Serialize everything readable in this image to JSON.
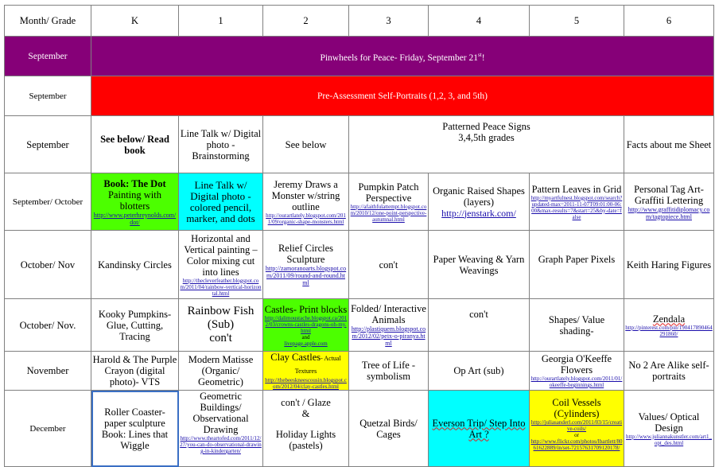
{
  "header": {
    "month_grade": "Month/ Grade",
    "grades": [
      "K",
      "1",
      "2",
      "3",
      "4",
      "5",
      "6"
    ]
  },
  "colors": {
    "purple_band": "#860078",
    "red_band": "#ff0000",
    "green": "#4cff00",
    "cyan": "#00ffff",
    "yellow": "#ffff00",
    "border": "#808080",
    "link": "#1a0dab"
  },
  "rows": {
    "r1": {
      "month": "September",
      "band_text": "Pinwheels for Peace-  Friday, September 21",
      "band_sup": "st",
      "band_end": "!"
    },
    "r2": {
      "month": "September",
      "band_text": "Pre-Assessment Self-Portraits (1,2, 3, and 5th)"
    },
    "r3": {
      "month": "September",
      "k": "See below/ Read book",
      "g1": "Line Talk w/ Digital photo - Brainstorming",
      "g2": "See below",
      "g345_line1": "Patterned Peace Signs",
      "g345_line2": "3,4,5th grades",
      "g6": "Facts about me Sheet"
    },
    "r4": {
      "month": "September/ October",
      "k_title": "Book: The Dot",
      "k_sub": "Painting with blotters",
      "k_link": "http://www.peterhreynolds.com/dot/",
      "g1": "Line Talk w/ Digital photo - colored pencil, marker, and dots",
      "g2_title": "Jeremy Draws a Monster w/string outline",
      "g2_link": "http://ourartlately.blogspot.com/2011/09/organic-shape-monsters.html",
      "g3_title": "Pumpkin Patch Perspective",
      "g3_link": "http://afaithfulattempt.blogspot.com/2010/12/one-point-perspective-autumnal.html",
      "g4_title": "Organic Raised Shapes (layers)",
      "g4_link": "http://jenstark.com/",
      "g5_title": "Pattern Leaves in Grid",
      "g5_link": "http://myartfulnest.blogspot.com/search?updated-max=2011-11-07T09:01:00-06:00&max-results=7&start=25&by-date=false",
      "g6_title": "Personal Tag Art- Graffiti Lettering",
      "g6_link": "http://www.graffitidiplomacy.com/tagtopiece.html"
    },
    "r5": {
      "month": "October/ Nov",
      "k": "Kandinsky Circles",
      "g1_title": "Horizontal and Vertical painting – Color mixing cut into lines",
      "g1_link": "http://thecleverfeather.blogspot.com/2011/04/rainbow-vertical-horizontal.html",
      "g2_title": "Relief Circles Sculpture",
      "g2_link": "http://zamoranoarts.blogspot.com/2011/09/round-and-round.html",
      "g3": "con't",
      "g4": "Paper Weaving & Yarn Weavings",
      "g5": "Graph Paper Pixels",
      "g6": "Keith Haring Figures"
    },
    "r6": {
      "month": "October/ Nov.",
      "k": "Kooky Pumpkins- Glue, Cutting, Tracing",
      "g1_line1": "Rainbow Fish",
      "g1_line2": "(Sub)",
      "g1_line3": "con't",
      "g2_title": "Castles- Print blocks",
      "g2_link": "http://dalimoustache.blogspot.ca/2012/03/crowns-castles-dragons-oh-my.html",
      "g2_and": "and",
      "g2_link2": "livepage.apple.com",
      "g3_title": "Folded/ Interactive Animals",
      "g3_link": "http://plastiquem.blogspot.com/2012/02/peix-o-piranya.html",
      "g4": "con't",
      "g5": "Shapes/ Value shading-",
      "g6_title": "Zendala",
      "g6_link": "http://pinterest.com/pin/190417890464291860/"
    },
    "r7": {
      "month": "November",
      "k": "Harold & The Purple Crayon (digital photo)- VTS",
      "g1": "Modern Matisse (Organic/ Geometric)",
      "g2_title": "Clay Castles",
      "g2_sub": "- Actual Textures",
      "g2_link": "http://thebeeskneescousin.blogspot.com/2012/04/clay-castles.html",
      "g3": "Tree of Life - symbolism",
      "g4": "Op Art (sub)",
      "g5_title": "Georgia O'Keeffe Flowers",
      "g5_link": "http://ourartlately.blogspot.com/2011/01/okeeffe-beginnings.html",
      "g6": "No 2 Are Alike self-portraits"
    },
    "r8": {
      "month": "December",
      "k": "Roller Coaster- paper sculpture Book: Lines that Wiggle",
      "g1_title": "Geometric Buildings/ Observational Drawing",
      "g1_link": "http://www.theartofed.com/2011/12/27/you-can-do-observational-drawing-in-kindergarten/",
      "g2_line1": "con't / Glaze",
      "g2_line2": "&",
      "g2_line3": "Holiday Lights (pastels)",
      "g3": "Quetzal Birds/ Cages",
      "g4": "Everson Trip/ Step Into Art ?",
      "g5_title": "Coil Vessels (Cylinders)",
      "g5_link": "http://juliasanderl.com/2011/03/15/creative-coils/",
      "g5_or": "or",
      "g5_link2": "http://www.flickr.com/photos/lbartlett/8061622889/in/set-72157631709120178/",
      "g6_title": "Values/ Optical Design",
      "g6_link": "http://www.juliannakunstler.com/art1_opt_des.html"
    }
  }
}
